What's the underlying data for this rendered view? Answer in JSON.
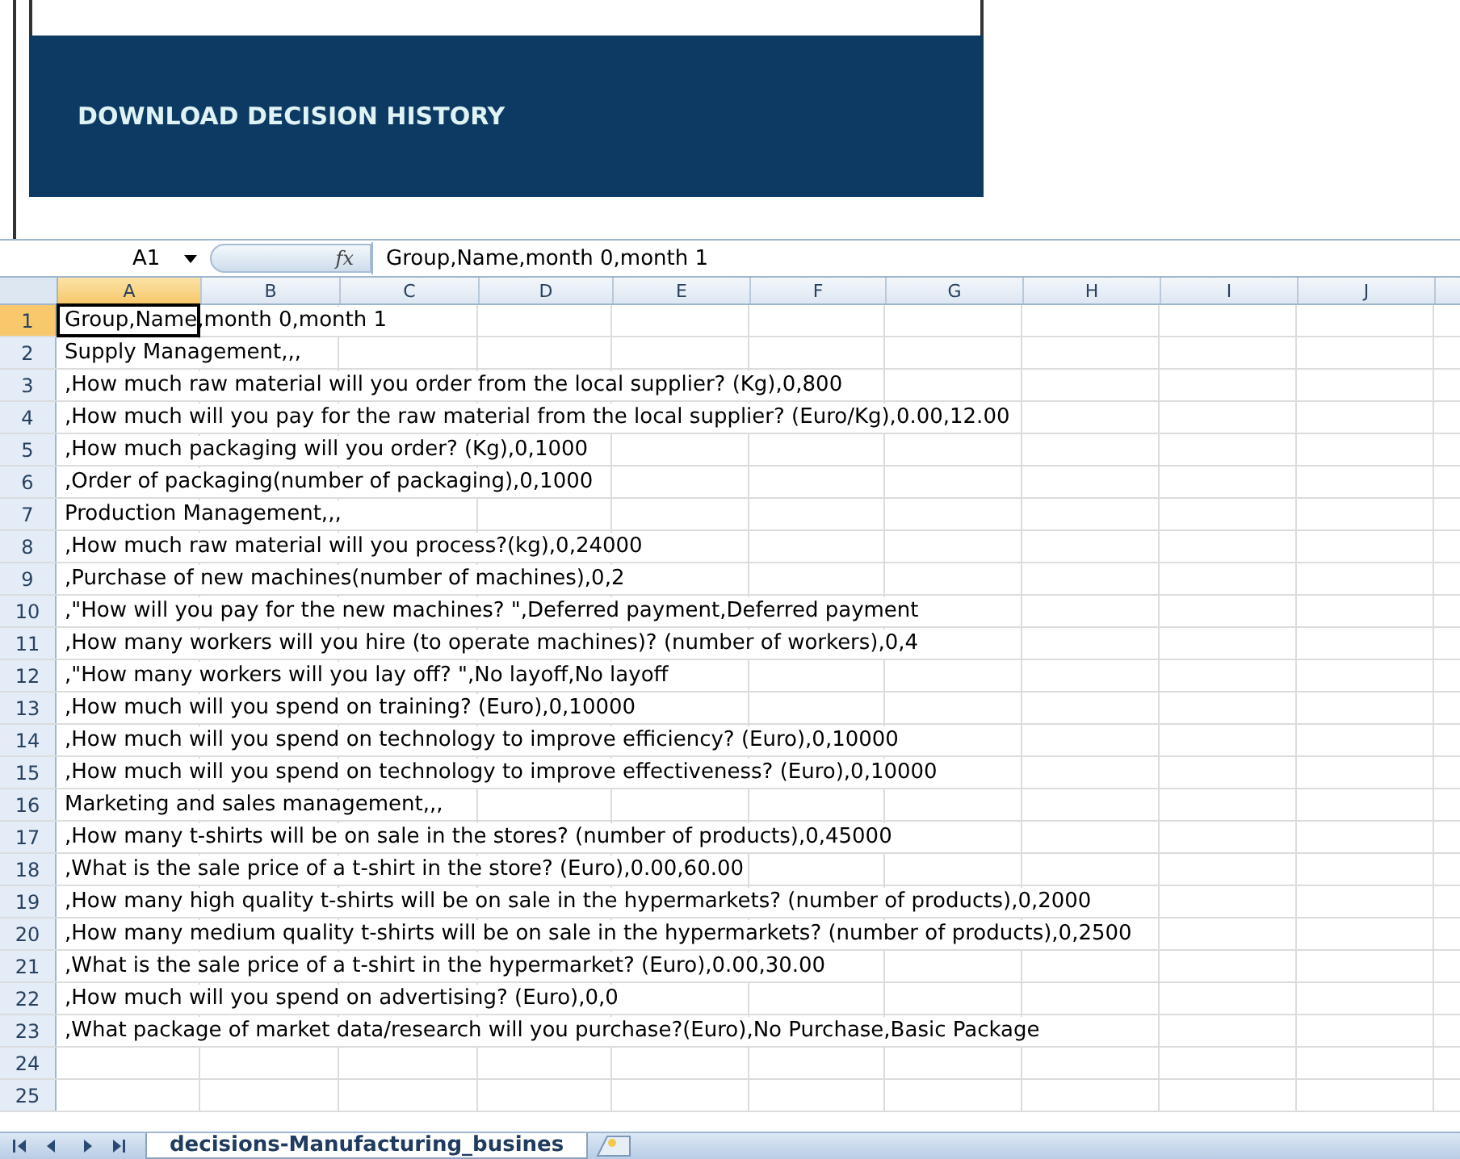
{
  "banner": {
    "title": "DOWNLOAD DECISION HISTORY"
  },
  "formula_bar": {
    "name_box": "A1",
    "function_label": "fx",
    "formula": "Group,Name,month 0,month 1"
  },
  "columns": [
    {
      "label": "A",
      "selected": true
    },
    {
      "label": "B",
      "selected": false
    },
    {
      "label": "C",
      "selected": false
    },
    {
      "label": "D",
      "selected": false
    },
    {
      "label": "E",
      "selected": false
    },
    {
      "label": "F",
      "selected": false
    },
    {
      "label": "G",
      "selected": false
    },
    {
      "label": "H",
      "selected": false
    },
    {
      "label": "I",
      "selected": false
    },
    {
      "label": "J",
      "selected": false
    }
  ],
  "rows": [
    {
      "number": "1",
      "text": "Group,Name,month 0,month 1",
      "selected": true
    },
    {
      "number": "2",
      "text": "Supply Management,,,",
      "selected": false
    },
    {
      "number": "3",
      "text": ",How much raw material will you order from the local supplier? (Kg),0,800",
      "selected": false
    },
    {
      "number": "4",
      "text": ",How much will you pay for the raw material from the local supplier? (Euro/Kg),0.00,12.00",
      "selected": false
    },
    {
      "number": "5",
      "text": ",How much packaging will you order? (Kg),0,1000",
      "selected": false
    },
    {
      "number": "6",
      "text": ",Order of packaging(number of packaging),0,1000",
      "selected": false
    },
    {
      "number": "7",
      "text": "Production Management,,,",
      "selected": false
    },
    {
      "number": "8",
      "text": ",How much raw material will you process?(kg),0,24000",
      "selected": false
    },
    {
      "number": "9",
      "text": ",Purchase of new machines(number of machines),0,2",
      "selected": false
    },
    {
      "number": "10",
      "text": ",\"How will you pay for the new machines? \",Deferred payment,Deferred payment",
      "selected": false
    },
    {
      "number": "11",
      "text": ",How many workers will you hire (to operate machines)? (number of workers),0,4",
      "selected": false
    },
    {
      "number": "12",
      "text": ",\"How many workers will you lay off? \",No layoff,No layoff",
      "selected": false
    },
    {
      "number": "13",
      "text": ",How much will you spend on training? (Euro),0,10000",
      "selected": false
    },
    {
      "number": "14",
      "text": ",How much will you spend on technology to improve efficiency? (Euro),0,10000",
      "selected": false
    },
    {
      "number": "15",
      "text": ",How much will you spend on technology to improve effectiveness? (Euro),0,10000",
      "selected": false
    },
    {
      "number": "16",
      "text": "Marketing and sales management,,,",
      "selected": false
    },
    {
      "number": "17",
      "text": ",How many t-shirts will be on sale in the stores? (number of products),0,45000",
      "selected": false
    },
    {
      "number": "18",
      "text": ",What is the sale price of a t-shirt in the store? (Euro),0.00,60.00",
      "selected": false
    },
    {
      "number": "19",
      "text": ",How many high quality t-shirts will be on sale in the hypermarkets? (number of products),0,2000",
      "selected": false
    },
    {
      "number": "20",
      "text": ",How many medium quality t-shirts will be on sale in the hypermarkets? (number of products),0,2500",
      "selected": false
    },
    {
      "number": "21",
      "text": ",What is the sale price of a t-shirt in the hypermarket? (Euro),0.00,30.00",
      "selected": false
    },
    {
      "number": "22",
      "text": ",How much will you spend on advertising? (Euro),0,0",
      "selected": false
    },
    {
      "number": "23",
      "text": ",What package of market data/research will you purchase?(Euro),No Purchase,Basic Package",
      "selected": false
    },
    {
      "number": "24",
      "text": "",
      "selected": false
    },
    {
      "number": "25",
      "text": "",
      "selected": false
    }
  ],
  "sheet_tabs": [
    {
      "label": "decisions-Manufacturing_busines",
      "selected": true
    }
  ]
}
